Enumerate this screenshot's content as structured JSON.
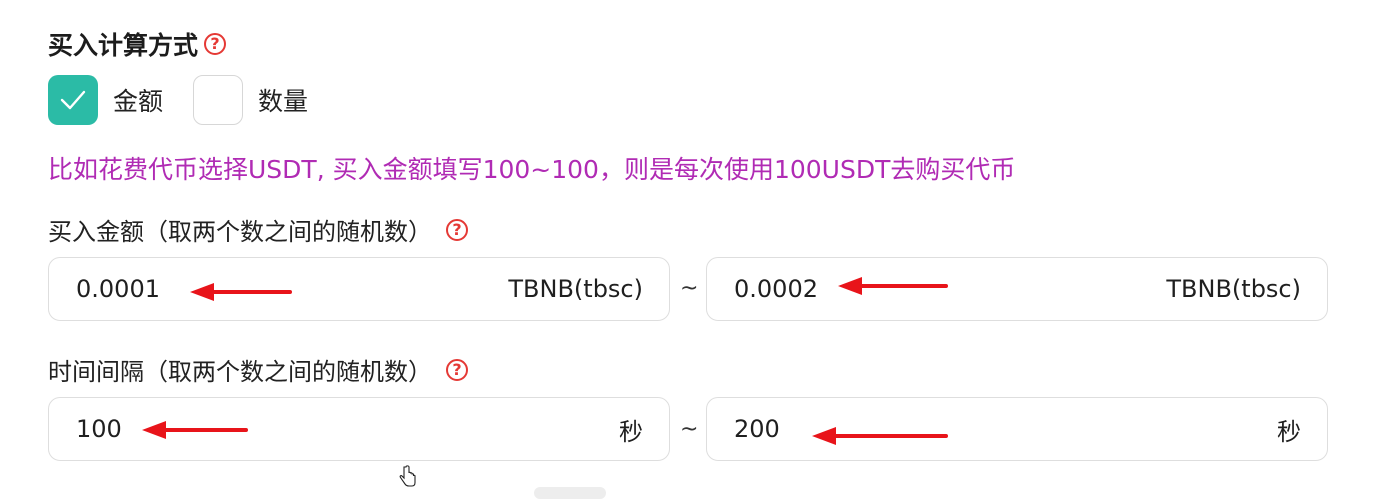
{
  "section": {
    "title": "买入计算方式"
  },
  "calc_mode": {
    "options": [
      {
        "label": "金额",
        "checked": true
      },
      {
        "label": "数量",
        "checked": false
      }
    ]
  },
  "hint": "比如花费代币选择USDT, 买入金额填写100~100，则是每次使用100USDT去购买代币",
  "amount": {
    "label": "买入金额（取两个数之间的随机数）",
    "min": "0.0001",
    "max": "0.0002",
    "unit": "TBNB(tbsc)",
    "separator": "~"
  },
  "interval": {
    "label": "时间间隔（取两个数之间的随机数）",
    "min": "100",
    "max": "200",
    "unit": "秒",
    "separator": "~"
  },
  "icons": {
    "help": "?",
    "check": "check-icon"
  },
  "colors": {
    "accent": "#2bbba6",
    "hint": "#b02bb4",
    "help": "#e53935",
    "arrow": "#e8141a"
  }
}
